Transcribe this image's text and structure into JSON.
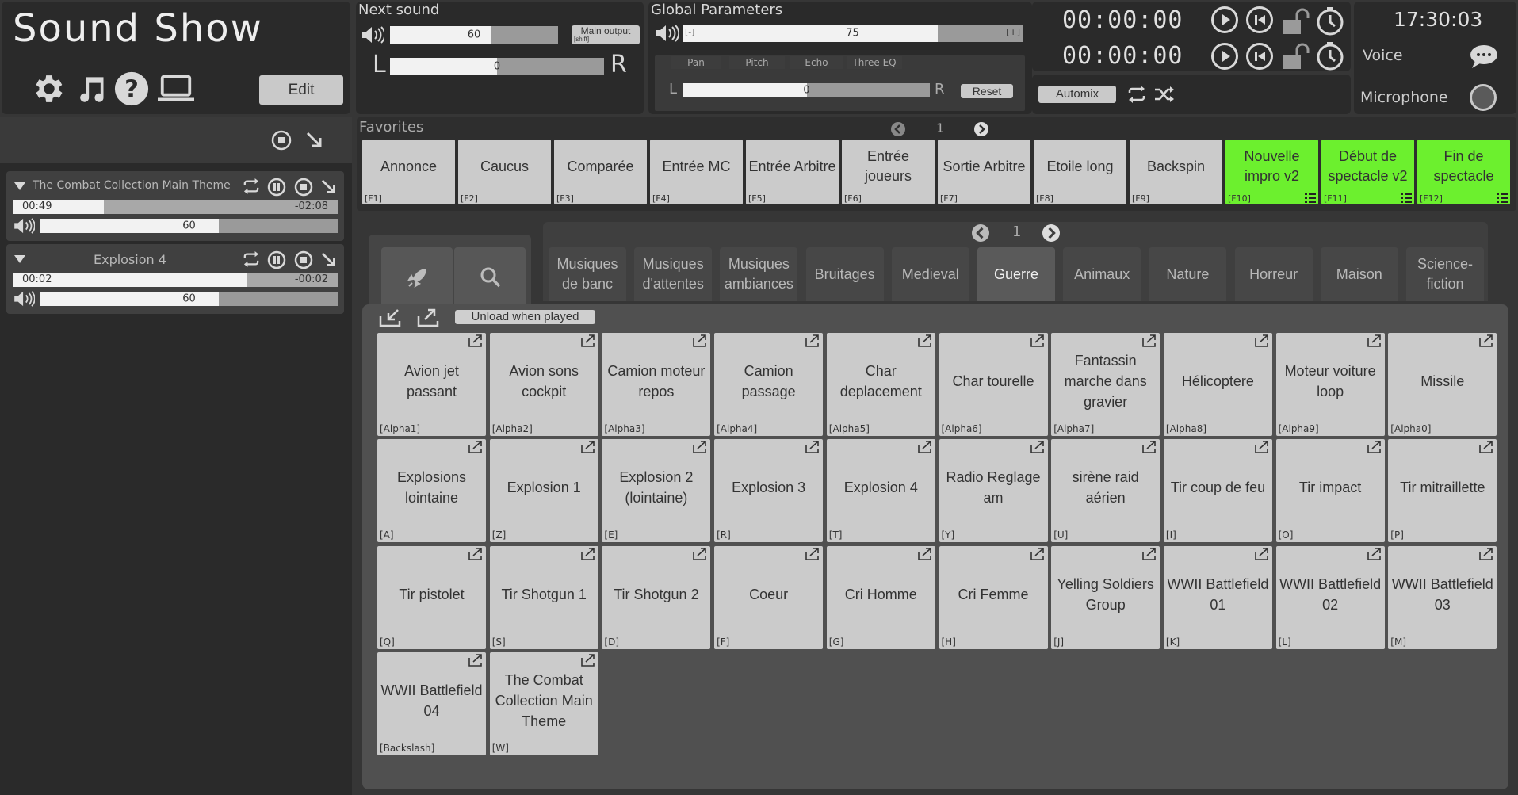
{
  "app": {
    "title": "Sound Show",
    "edit_label": "Edit"
  },
  "next_sound": {
    "label": "Next sound",
    "volume": 60,
    "volume_fraction": 0.6,
    "pan": 0,
    "pan_fraction": 0.5,
    "left": "L",
    "right": "R",
    "main_output_label": "Main output",
    "main_output_sub": "[shift]"
  },
  "global": {
    "label": "Global Parameters",
    "value": 75,
    "value_fraction": 0.75,
    "minus": "[-]",
    "plus": "[+]",
    "tabs": [
      "Pan",
      "Pitch",
      "Echo",
      "Three EQ"
    ],
    "pan": 0,
    "pan_fraction": 0.5,
    "left": "L",
    "right": "R",
    "reset_label": "Reset"
  },
  "timers": {
    "time1": "00:00:00",
    "time2": "00:00:00",
    "automix_label": "Automix"
  },
  "clock": {
    "time": "17:30:03",
    "voice_label": "Voice",
    "microphone_label": "Microphone"
  },
  "players": [
    {
      "name": "The Combat Collection Main Theme",
      "elapsed": "00:49",
      "remaining": "-02:08",
      "progress": 0.28,
      "volume": 60,
      "volume_fraction": 0.6
    },
    {
      "name": "Explosion 4",
      "elapsed": "00:02",
      "remaining": "-00:02",
      "progress": 0.72,
      "volume": 60,
      "volume_fraction": 0.6
    }
  ],
  "favorites": {
    "label": "Favorites",
    "page": "1",
    "items": [
      {
        "label": "Annonce",
        "key": "[F1]",
        "active": false
      },
      {
        "label": "Caucus",
        "key": "[F2]",
        "active": false
      },
      {
        "label": "Comparée",
        "key": "[F3]",
        "active": false
      },
      {
        "label": "Entrée MC",
        "key": "[F4]",
        "active": false
      },
      {
        "label": "Entrée Arbitre",
        "key": "[F5]",
        "active": false
      },
      {
        "label": "Entrée joueurs",
        "key": "[F6]",
        "active": false
      },
      {
        "label": "Sortie Arbitre",
        "key": "[F7]",
        "active": false
      },
      {
        "label": "Etoile long",
        "key": "[F8]",
        "active": false
      },
      {
        "label": "Backspin",
        "key": "[F9]",
        "active": false
      },
      {
        "label": "Nouvelle impro v2",
        "key": "[F10]",
        "active": true
      },
      {
        "label": "Début de spectacle v2",
        "key": "[F11]",
        "active": true
      },
      {
        "label": "Fin de spectacle",
        "key": "[F12]",
        "active": true
      }
    ]
  },
  "library": {
    "page": "1",
    "unload_label": "Unload when played",
    "tabs": [
      {
        "label": "Musiques de banc",
        "active": false
      },
      {
        "label": "Musiques d'attentes",
        "active": false
      },
      {
        "label": "Musiques ambiances",
        "active": false
      },
      {
        "label": "Bruitages",
        "active": false
      },
      {
        "label": "Medieval",
        "active": false
      },
      {
        "label": "Guerre",
        "active": true
      },
      {
        "label": "Animaux",
        "active": false
      },
      {
        "label": "Nature",
        "active": false
      },
      {
        "label": "Horreur",
        "active": false
      },
      {
        "label": "Maison",
        "active": false
      },
      {
        "label": "Science-fiction",
        "active": false
      }
    ],
    "sounds": [
      {
        "label": "Avion jet passant",
        "key": "[Alpha1]"
      },
      {
        "label": "Avion sons cockpit",
        "key": "[Alpha2]"
      },
      {
        "label": "Camion moteur repos",
        "key": "[Alpha3]"
      },
      {
        "label": "Camion passage",
        "key": "[Alpha4]"
      },
      {
        "label": "Char deplacement",
        "key": "[Alpha5]"
      },
      {
        "label": "Char tourelle",
        "key": "[Alpha6]"
      },
      {
        "label": "Fantassin marche dans gravier",
        "key": "[Alpha7]"
      },
      {
        "label": "Hélicoptere",
        "key": "[Alpha8]"
      },
      {
        "label": "Moteur voiture loop",
        "key": "[Alpha9]"
      },
      {
        "label": "Missile",
        "key": "[Alpha0]"
      },
      {
        "label": "Explosions lointaine",
        "key": "[A]"
      },
      {
        "label": "Explosion 1",
        "key": "[Z]"
      },
      {
        "label": "Explosion 2 (lointaine)",
        "key": "[E]"
      },
      {
        "label": "Explosion 3",
        "key": "[R]"
      },
      {
        "label": "Explosion 4",
        "key": "[T]"
      },
      {
        "label": "Radio Reglage am",
        "key": "[Y]"
      },
      {
        "label": "sirène raid aérien",
        "key": "[U]"
      },
      {
        "label": "Tir coup de feu",
        "key": "[I]"
      },
      {
        "label": "Tir impact",
        "key": "[O]"
      },
      {
        "label": "Tir mitraillette",
        "key": "[P]"
      },
      {
        "label": "Tir pistolet",
        "key": "[Q]"
      },
      {
        "label": "Tir Shotgun 1",
        "key": "[S]"
      },
      {
        "label": "Tir Shotgun 2",
        "key": "[D]"
      },
      {
        "label": "Coeur",
        "key": "[F]"
      },
      {
        "label": "Cri Homme",
        "key": "[G]"
      },
      {
        "label": "Cri Femme",
        "key": "[H]"
      },
      {
        "label": "Yelling Soldiers Group",
        "key": "[J]"
      },
      {
        "label": "WWII Battlefield 01",
        "key": "[K]"
      },
      {
        "label": "WWII Battlefield 02",
        "key": "[L]"
      },
      {
        "label": "WWII Battlefield 03",
        "key": "[M]"
      },
      {
        "label": "WWII Battlefield 04",
        "key": "[Backslash]"
      },
      {
        "label": "The Combat Collection Main Theme",
        "key": "[W]"
      }
    ]
  },
  "icons": {
    "settings": "gear-icon",
    "music": "music-note-icon",
    "help": "help-icon",
    "screen": "laptop-icon",
    "speaker": "speaker-icon",
    "loop": "loop-icon",
    "pause": "pause-icon",
    "stop": "stop-icon",
    "fade": "fade-out-icon",
    "play": "play-icon",
    "previous": "skip-back-icon",
    "lock": "unlock-icon",
    "timer": "timer-icon",
    "shuffle": "shuffle-icon",
    "chat": "chat-bubble-icon",
    "record": "mic-toggle-icon",
    "rocket": "rocket-icon",
    "search": "search-icon",
    "import": "import-icon",
    "export": "export-icon",
    "popout": "popout-icon",
    "chevron_left": "chevron-left-icon",
    "chevron_right": "chevron-right-icon"
  },
  "colors": {
    "active_favorite": "#6cf02e",
    "background": "#363636",
    "panel": "#2a2a2a",
    "tile": "#cbcbcb"
  }
}
